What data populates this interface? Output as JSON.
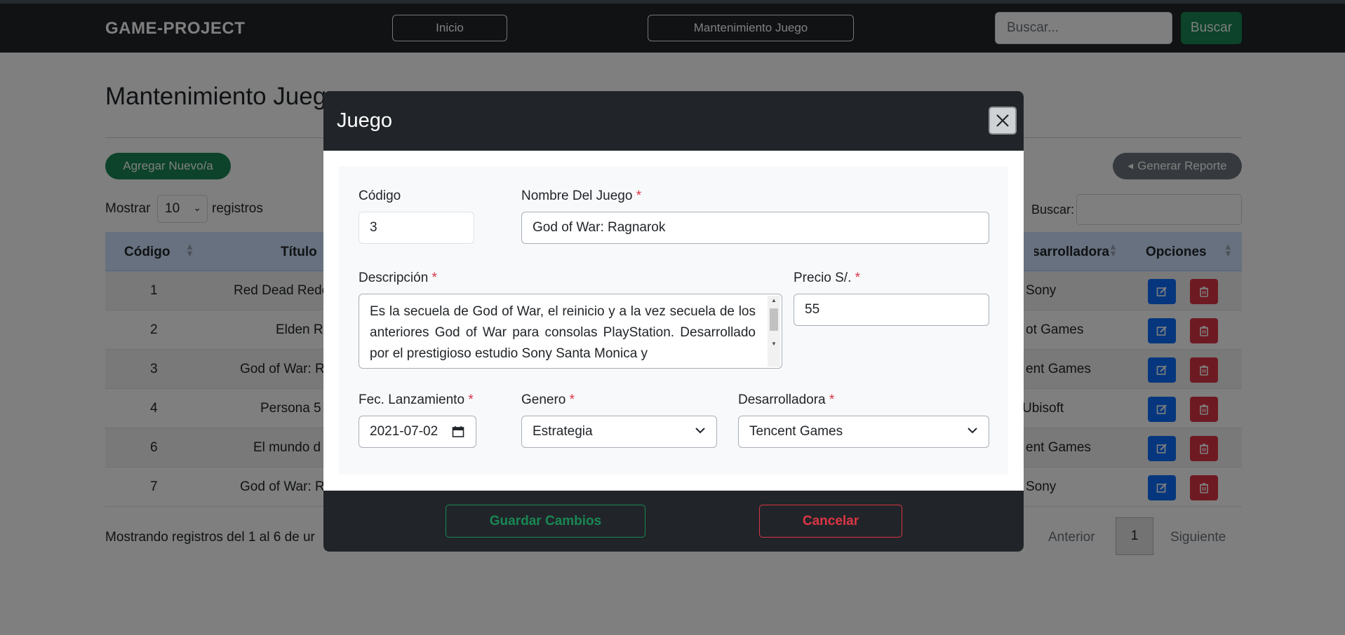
{
  "navbar": {
    "brand": "GAME-PROJECT",
    "links": [
      "Inicio",
      "Mantenimiento Juego"
    ],
    "search_placeholder": "Buscar...",
    "search_button": "Buscar"
  },
  "page": {
    "title": "Mantenimiento Juego",
    "add_button": "Agregar Nuevo/a",
    "report_button": "Generar Reporte",
    "show_label": "Mostrar",
    "show_value": "10",
    "records_label": "registros",
    "search_label": "Buscar:",
    "table": {
      "headers": [
        "Código",
        "Título",
        "Desarrolladora",
        "Opciones"
      ],
      "rows": [
        {
          "codigo": "1",
          "titulo": "Red Dead Rede",
          "desarrolladora": "Sony"
        },
        {
          "codigo": "2",
          "titulo": "Elden Ri",
          "desarrolladora": "ot Games"
        },
        {
          "codigo": "3",
          "titulo": "God of War: R",
          "desarrolladora": "ent Games"
        },
        {
          "codigo": "4",
          "titulo": "Persona 5",
          "desarrolladora": "Ubisoft"
        },
        {
          "codigo": "6",
          "titulo": "El mundo d",
          "desarrolladora": "ent Games"
        },
        {
          "codigo": "7",
          "titulo": "God of War: R",
          "desarrolladora": "Sony"
        }
      ]
    },
    "info": "Mostrando registros del 1 al 6 de ur",
    "pagination": {
      "prev": "Anterior",
      "page": "1",
      "next": "Siguiente"
    }
  },
  "modal": {
    "title": "Juego",
    "fields": {
      "codigo_label": "Código",
      "codigo_value": "3",
      "nombre_label": "Nombre Del Juego",
      "nombre_value": "God of War: Ragnarok",
      "descripcion_label": "Descripción",
      "descripcion_value": "Es la secuela de God of War, el reinicio y a la vez secuela de los anteriores God of War para consolas PlayStation. Desarrollado por el prestigioso estudio Sony Santa Monica y",
      "precio_label": "Precio S/.",
      "precio_value": "55",
      "fecha_label": "Fec. Lanzamiento",
      "fecha_value": "2021-07-02",
      "genero_label": "Genero",
      "genero_value": "Estrategia",
      "desarrolladora_label": "Desarrolladora",
      "desarrolladora_value": "Tencent Games",
      "required_mark": "*"
    },
    "save_button": "Guardar Cambios",
    "cancel_button": "Cancelar"
  },
  "colors": {
    "navbar": "#212529",
    "success": "#198754",
    "danger": "#dc3545",
    "primary": "#0d6efd",
    "table_header": "#cfe2ff"
  }
}
